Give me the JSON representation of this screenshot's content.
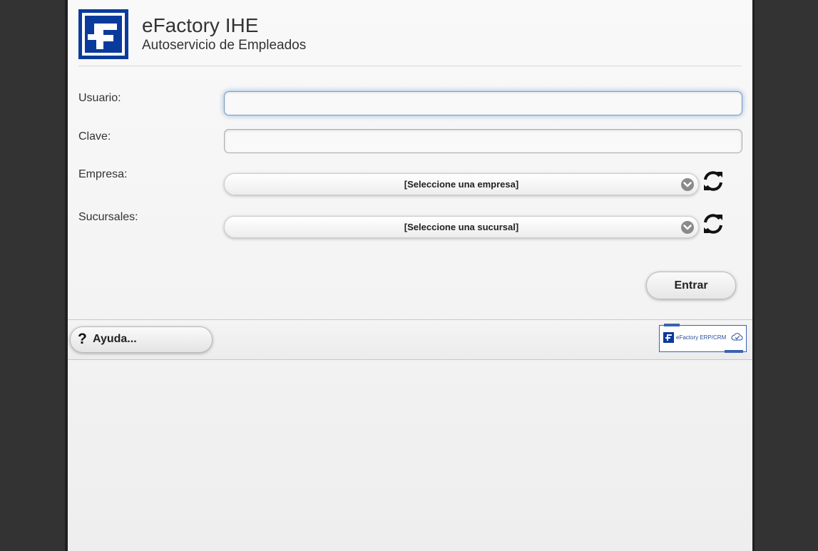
{
  "header": {
    "title": "eFactory IHE",
    "subtitle": "Autoservicio de Empleados",
    "logo_icon": "efactory-logo-icon"
  },
  "form": {
    "usuario_label": "Usuario:",
    "usuario_value": "",
    "clave_label": "Clave:",
    "clave_value": "",
    "empresa_label": "Empresa:",
    "empresa_selected": "[Seleccione una empresa]",
    "sucursales_label": "Sucursales:",
    "sucursal_selected": "[Seleccione una sucursal]",
    "submit_label": "Entrar"
  },
  "footer": {
    "help_label": "Ayuda...",
    "help_icon": "question-icon",
    "badge_text": "eFactory ERP/CRM",
    "badge_icon": "cloud-check-icon"
  },
  "colors": {
    "brand_blue": "#0a3b9c",
    "focus_glow": "#8fb0e0"
  }
}
